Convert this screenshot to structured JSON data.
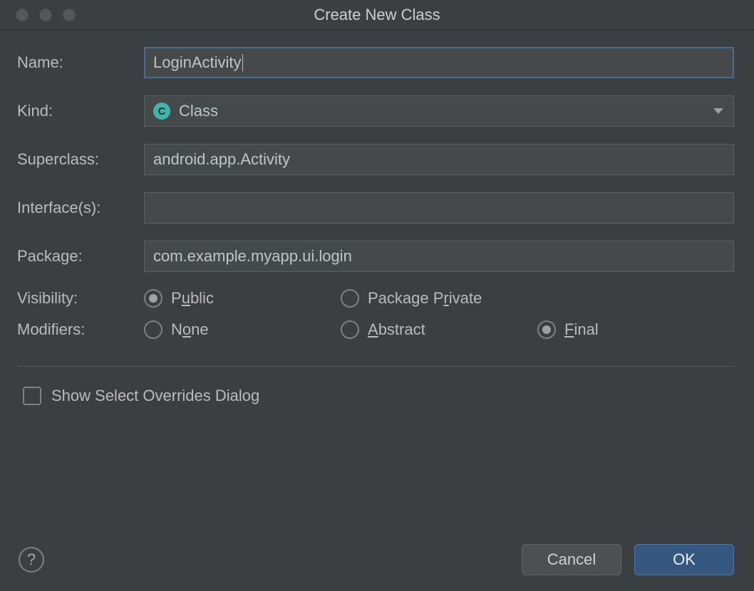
{
  "window": {
    "title": "Create New Class"
  },
  "labels": {
    "name": "Name:",
    "kind": "Kind:",
    "superclass": "Superclass:",
    "interfaces": "Interface(s):",
    "package": "Package:",
    "visibility": "Visibility:",
    "modifiers": "Modifiers:"
  },
  "fields": {
    "name": "LoginActivity",
    "kind_icon_letter": "C",
    "kind": "Class",
    "superclass": "android.app.Activity",
    "interfaces": "",
    "package": "com.example.myapp.ui.login"
  },
  "visibility": {
    "public_prefix": "P",
    "public_mn": "u",
    "public_suffix": "blic",
    "private_prefix": "Package P",
    "private_mn": "r",
    "private_suffix": "ivate",
    "selected": "public"
  },
  "modifiers": {
    "none_prefix": "N",
    "none_mn": "o",
    "none_suffix": "ne",
    "abstract_mn": "A",
    "abstract_suffix": "bstract",
    "final_mn": "F",
    "final_suffix": "inal",
    "selected": "final"
  },
  "checkbox": {
    "show_overrides_label": "Show Select Overrides Dialog",
    "show_overrides_checked": false
  },
  "buttons": {
    "help": "?",
    "cancel": "Cancel",
    "ok": "OK"
  }
}
